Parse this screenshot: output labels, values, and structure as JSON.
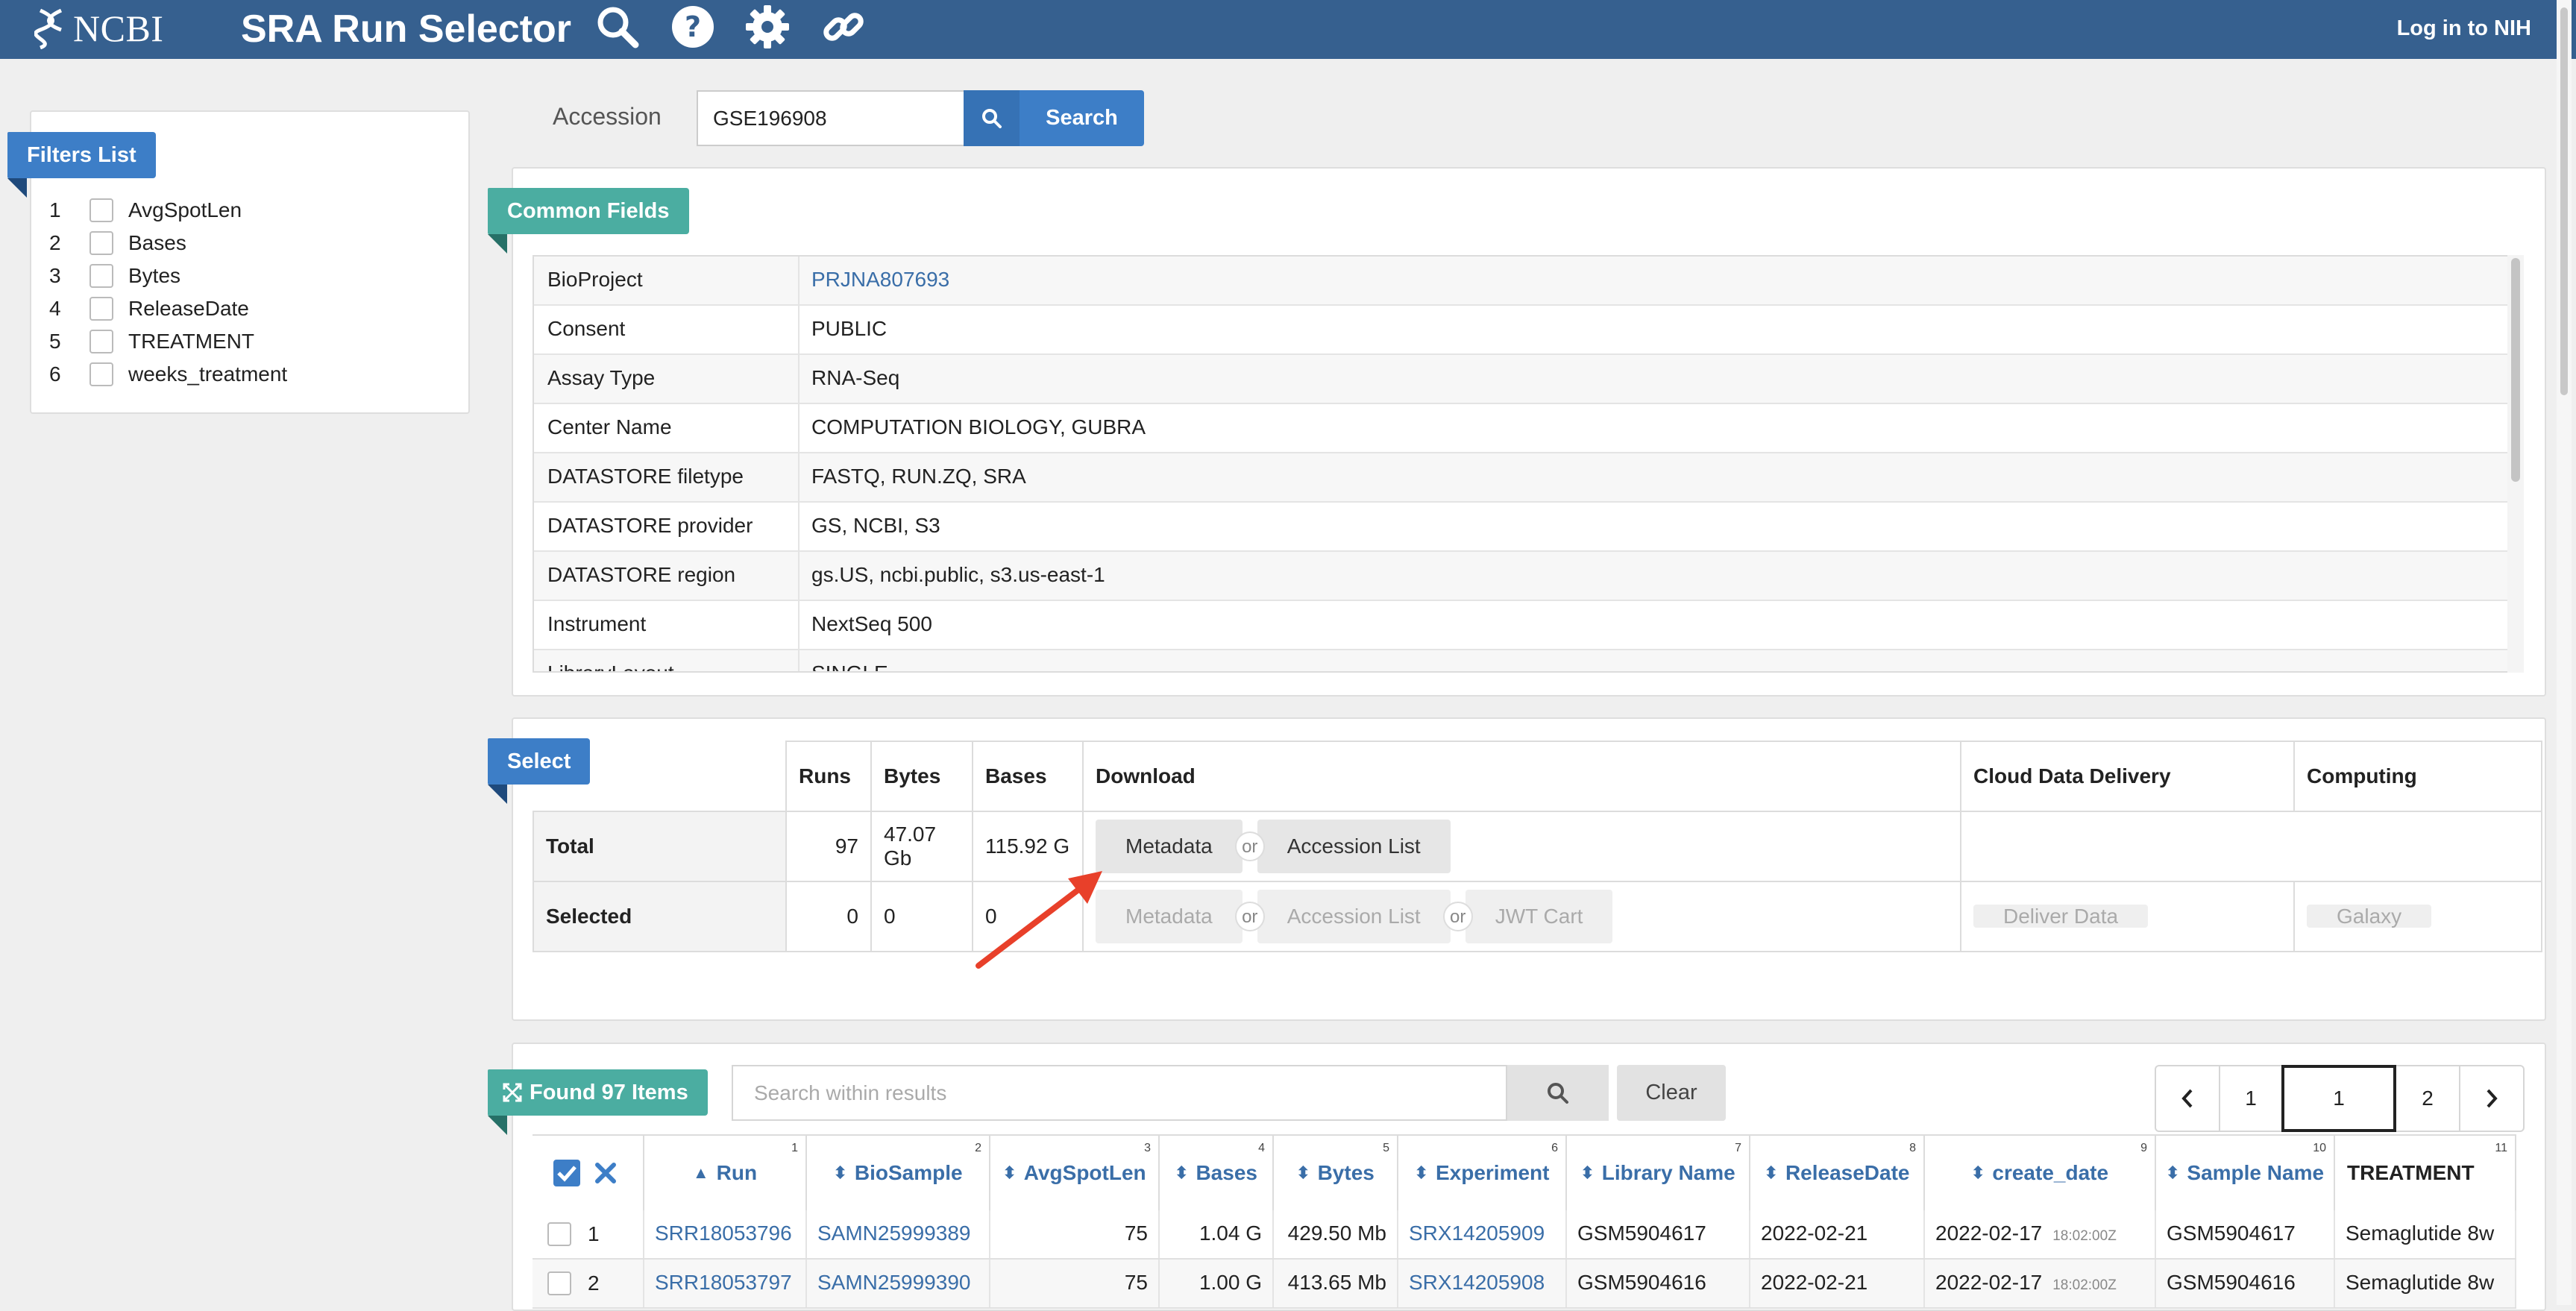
{
  "header": {
    "logo_text": "NCBI",
    "title": "SRA Run Selector",
    "icons": [
      "search-icon",
      "help-icon",
      "gear-icon",
      "link-icon"
    ],
    "login": "Log in to NIH"
  },
  "filters": {
    "title": "Filters List",
    "items": [
      {
        "num": "1",
        "label": "AvgSpotLen"
      },
      {
        "num": "2",
        "label": "Bases"
      },
      {
        "num": "3",
        "label": "Bytes"
      },
      {
        "num": "4",
        "label": "ReleaseDate"
      },
      {
        "num": "5",
        "label": "TREATMENT"
      },
      {
        "num": "6",
        "label": "weeks_treatment"
      }
    ]
  },
  "accession": {
    "label": "Accession",
    "value": "GSE196908",
    "search_label": "Search"
  },
  "common_fields": {
    "title": "Common Fields",
    "rows": [
      {
        "key": "BioProject",
        "value": "PRJNA807693"
      },
      {
        "key": "Consent",
        "value": "PUBLIC"
      },
      {
        "key": "Assay Type",
        "value": "RNA-Seq"
      },
      {
        "key": "Center Name",
        "value": "COMPUTATION BIOLOGY, GUBRA"
      },
      {
        "key": "DATASTORE filetype",
        "value": "FASTQ, RUN.ZQ, SRA"
      },
      {
        "key": "DATASTORE provider",
        "value": "GS, NCBI, S3"
      },
      {
        "key": "DATASTORE region",
        "value": "gs.US, ncbi.public, s3.us-east-1"
      },
      {
        "key": "Instrument",
        "value": "NextSeq 500"
      },
      {
        "key": "LibraryLayout",
        "value": "SINGLE"
      }
    ]
  },
  "select": {
    "title": "Select",
    "headers": {
      "runs": "Runs",
      "bytes": "Bytes",
      "bases": "Bases",
      "download": "Download",
      "cloud": "Cloud Data Delivery",
      "computing": "Computing"
    },
    "total": {
      "label": "Total",
      "runs": "97",
      "bytes": "47.07 Gb",
      "bases": "115.92 G",
      "metadata": "Metadata",
      "or": "or",
      "accession_list": "Accession List"
    },
    "selected": {
      "label": "Selected",
      "runs": "0",
      "bytes": "0",
      "bases": "0",
      "metadata": "Metadata",
      "or": "or",
      "accession_list": "Accession List",
      "jwt_cart": "JWT Cart",
      "deliver": "Deliver Data",
      "galaxy": "Galaxy"
    }
  },
  "results": {
    "found_label": "Found 97 Items",
    "search_placeholder": "Search within results",
    "clear_label": "Clear",
    "pages": {
      "first": "1",
      "current": "1",
      "next": "2"
    },
    "columns": [
      {
        "label": "Run",
        "num": "1"
      },
      {
        "label": "BioSample",
        "num": "2"
      },
      {
        "label": "AvgSpotLen",
        "num": "3"
      },
      {
        "label": "Bases",
        "num": "4"
      },
      {
        "label": "Bytes",
        "num": "5"
      },
      {
        "label": "Experiment",
        "num": "6"
      },
      {
        "label": "Library Name",
        "num": "7"
      },
      {
        "label": "ReleaseDate",
        "num": "8"
      },
      {
        "label": "create_date",
        "num": "9"
      },
      {
        "label": "Sample Name",
        "num": "10"
      },
      {
        "label": "TREATMENT",
        "num": "11"
      }
    ],
    "rows": [
      {
        "idx": "1",
        "run": "SRR18053796",
        "biosample": "SAMN25999389",
        "avgspotlen": "75",
        "bases": "1.04 G",
        "bytes": "429.50 Mb",
        "experiment": "SRX14205909",
        "library": "GSM5904617",
        "release": "2022-02-21",
        "create": "2022-02-17",
        "create_time": "18:02:00Z",
        "sample": "GSM5904617",
        "treatment": "Semaglutide 8w"
      },
      {
        "idx": "2",
        "run": "SRR18053797",
        "biosample": "SAMN25999390",
        "avgspotlen": "75",
        "bases": "1.00 G",
        "bytes": "413.65 Mb",
        "experiment": "SRX14205908",
        "library": "GSM5904616",
        "release": "2022-02-21",
        "create": "2022-02-17",
        "create_time": "18:02:00Z",
        "sample": "GSM5904616",
        "treatment": "Semaglutide 8w"
      }
    ]
  },
  "colors": {
    "header": "#36608f",
    "blue": "#3d7ec7",
    "teal": "#4bada1",
    "link": "#3a6ea8",
    "arrow": "#e8402a"
  }
}
